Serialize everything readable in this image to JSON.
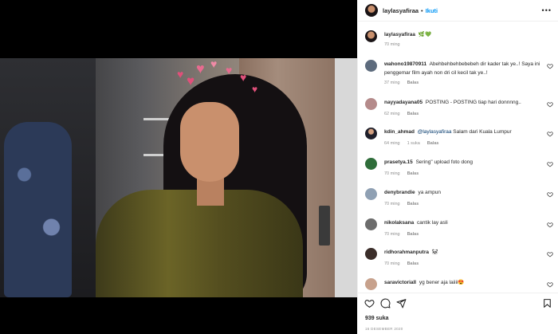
{
  "header": {
    "username": "laylasyafiraa",
    "separator": "•",
    "follow_label": "Ikuti",
    "more_label": "•••"
  },
  "caption": {
    "username": "laylasyafiraa",
    "text": "🌿💚",
    "time": "70 ming"
  },
  "comments": [
    {
      "username": "wahono19870911",
      "text": "Abehbehbehbebebeh dir kader tak ye..! Saya ini penggemar film ayah non dri cil kecil tak ye..!",
      "time": "37 ming",
      "likes": "",
      "reply": "Balas",
      "avatar_color": "#5d6b7d"
    },
    {
      "username": "nayyadayana05",
      "text": "POSTING - POSTING tiap hari donnnng..",
      "time": "62 ming",
      "likes": "",
      "reply": "Balas",
      "avatar_color": "#b48a8a"
    },
    {
      "username": "kdin_ahmad",
      "mention": "@laylasyafiraa",
      "text": "Salam dari Kuala Lumpur",
      "time": "64 ming",
      "likes": "1 suka",
      "reply": "Balas",
      "avatar_color": "#2b2b3a"
    },
    {
      "username": "prasetya.15",
      "text": "Sering\" upload foto dong",
      "time": "70 ming",
      "likes": "",
      "reply": "Balas",
      "avatar_color": "#2f6d3a"
    },
    {
      "username": "denybrandie",
      "text": "ya ampun",
      "time": "70 ming",
      "likes": "",
      "reply": "Balas",
      "avatar_color": "#8fa0b3"
    },
    {
      "username": "nikolaksana",
      "text": "cantik lay asli",
      "time": "70 ming",
      "likes": "",
      "reply": "Balas",
      "avatar_color": "#6c6c6c"
    },
    {
      "username": "ridhorahmanputra",
      "text": "🐼",
      "time": "70 ming",
      "likes": "",
      "reply": "Balas",
      "avatar_color": "#3b2e2a"
    },
    {
      "username": "saravictoriall",
      "text": "yg bener aja laiiii😍",
      "time": "",
      "likes": "",
      "reply": "",
      "avatar_color": "#c7a18c"
    }
  ],
  "footer": {
    "likes_count": "939 suka",
    "date": "16 DESEMBER 2020"
  },
  "icons": {
    "like": "heart-icon",
    "comment": "comment-icon",
    "share": "share-icon",
    "save": "bookmark-icon"
  }
}
